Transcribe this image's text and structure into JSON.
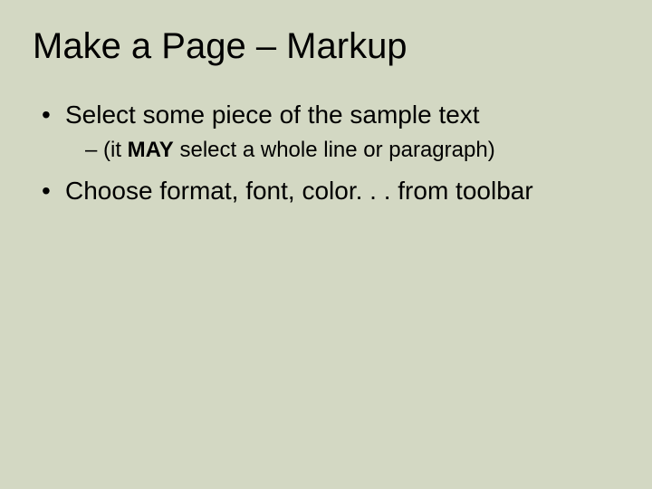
{
  "title": "Make a Page – Markup",
  "bullets": {
    "item1": "Select some piece of the sample text",
    "item1_sub_pre": "(it ",
    "item1_sub_bold": "MAY",
    "item1_sub_post": " select a whole line or paragraph)",
    "item2": "Choose format, font, color. . . from toolbar"
  }
}
